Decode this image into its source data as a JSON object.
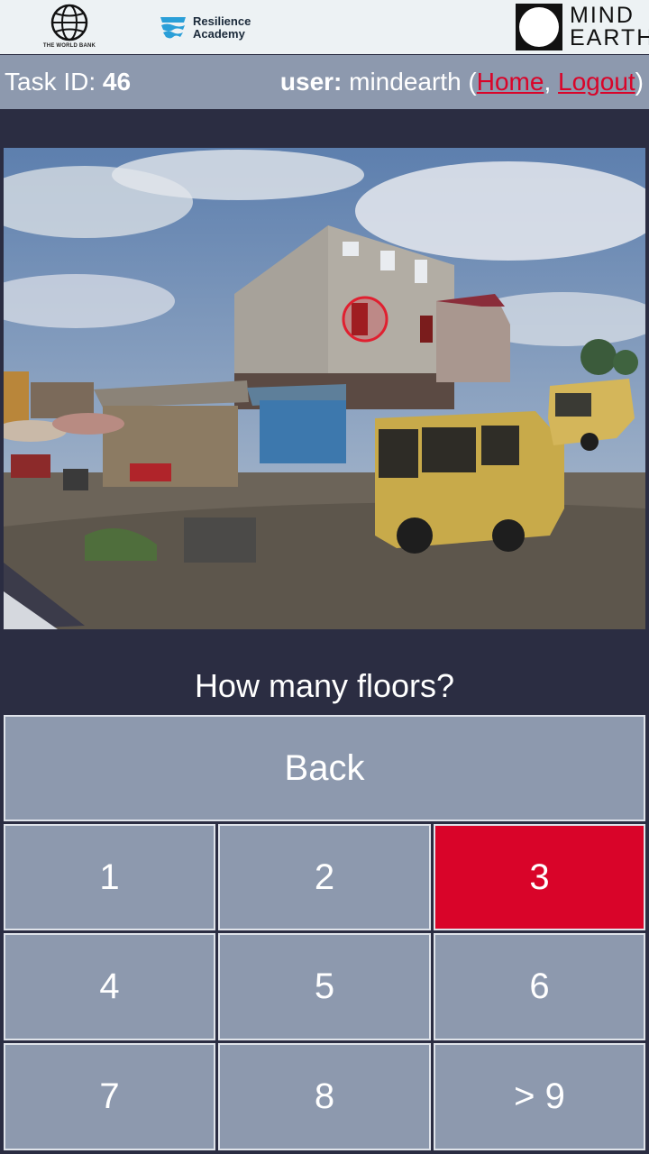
{
  "logos": {
    "world_bank_caption": "THE WORLD BANK",
    "resilience_line1": "Resilience",
    "resilience_line2": "Academy",
    "mindearth_line1": "MIND",
    "mindearth_line2": "EARTH"
  },
  "header": {
    "task_label": "Task ID:",
    "task_id": "46",
    "user_label": "user:",
    "username": "mindearth",
    "home_link": "Home",
    "logout_link": "Logout"
  },
  "question": "How many floors?",
  "buttons": {
    "back": "Back",
    "options": [
      "1",
      "2",
      "3",
      "4",
      "5",
      "6",
      "7",
      "8",
      "> 9"
    ],
    "selected": "3"
  },
  "colors": {
    "background": "#2b2d42",
    "button": "#8d99ae",
    "accent": "#d90429",
    "logo_bar": "#edf2f4"
  }
}
